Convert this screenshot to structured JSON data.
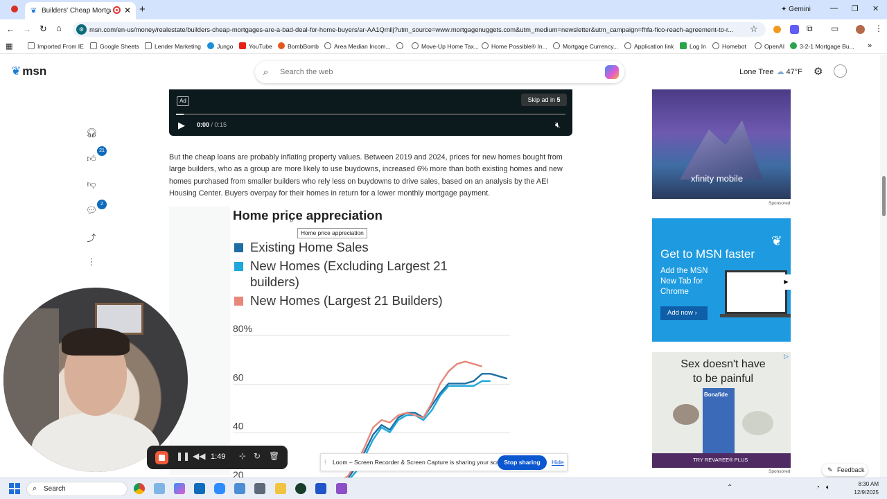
{
  "browser": {
    "tab_title": "Builders' Cheap Mortgages",
    "new_tab": "+",
    "gemini_label": "Gemini",
    "url": "msn.com/en-us/money/realestate/builders-cheap-mortgages-are-a-bad-deal-for-home-buyers/ar-AA1Qmilj?utm_source=www.mortgagenuggets.com&utm_medium=newsletter&utm_campaign=fhfa-fico-reach-agreement-to-r...",
    "bookmarks": [
      {
        "label": "Imported From IE",
        "color": "#6b6b6b"
      },
      {
        "label": "Google Sheets",
        "color": "#6b6b6b"
      },
      {
        "label": "Lender Marketing",
        "color": "#6b6b6b"
      },
      {
        "label": "Jungo",
        "color": "#1c8fd6"
      },
      {
        "label": "YouTube",
        "color": "#e62117"
      },
      {
        "label": "BombBomb",
        "color": "#e2591d"
      },
      {
        "label": "Area Median Incom...",
        "color": "#555555"
      },
      {
        "label": "Move-Up Home Tax...",
        "color": "#555555"
      },
      {
        "label": "Home Possible® In...",
        "color": "#555555"
      },
      {
        "label": "Mortgage Currency...",
        "color": "#555555"
      },
      {
        "label": "Application link",
        "color": "#555555"
      },
      {
        "label": "Log In",
        "color": "#2aa34a"
      },
      {
        "label": "Homebot",
        "color": "#555555"
      },
      {
        "label": "OpenAI",
        "color": "#555555"
      },
      {
        "label": "3-2-1 Mortgage Bu...",
        "color": "#2aa34a"
      }
    ]
  },
  "msn": {
    "logo": "msn",
    "search_placeholder": "Search the web",
    "location": "Lone Tree",
    "temperature": "47°F"
  },
  "left_rail": {
    "like_count": "21",
    "comment_count": "2"
  },
  "video": {
    "ad_label": "Ad",
    "skip_label": "Skip ad in",
    "skip_seconds": "5",
    "time_current": "0:00",
    "time_total": "/ 0:15",
    "progress_fraction": 0.02
  },
  "article": {
    "paragraph": "But the cheap loans are probably inflating property values. Between 2019 and 2024, prices for new homes bought from large builders, who as a group are more likely to use buydowns, increased 6% more than both existing homes and new homes purchased from smaller builders who rely less on buydowns to drive sales, based on an analysis by the AEI Housing Center. Buyers overpay for their homes in return for a lower monthly mortgage payment."
  },
  "chart_data": {
    "type": "line",
    "title": "Home price appreciation",
    "tooltip": "Home price appreciation",
    "ylim": [
      20,
      80
    ],
    "yticks": [
      {
        "value": 80,
        "label": "80%"
      },
      {
        "value": 60,
        "label": "60"
      },
      {
        "value": 40,
        "label": "40"
      },
      {
        "value": 20,
        "label": "20"
      }
    ],
    "x": [
      0,
      1,
      2,
      3,
      4,
      5,
      6,
      7,
      8,
      9,
      10,
      11,
      12,
      13,
      14,
      15,
      16,
      17,
      18,
      19,
      20
    ],
    "series": [
      {
        "name": "Existing Home Sales",
        "color": "#1d6fa3",
        "values": [
          18,
          19,
          24,
          30,
          37,
          41,
          39,
          44,
          46,
          46,
          44,
          49,
          54,
          58,
          58,
          58,
          59,
          62,
          62,
          61,
          60
        ]
      },
      {
        "name": "New Homes (Excluding Largest 21 builders)",
        "color": "#1ea8dc",
        "values": [
          17,
          18,
          22,
          28,
          35,
          40,
          38,
          43,
          45,
          45,
          43,
          47,
          53,
          57,
          57,
          57,
          57,
          59,
          59,
          null,
          null
        ]
      },
      {
        "name": "New Homes (Largest 21 Builders)",
        "color": "#e8877a",
        "values": [
          18,
          20,
          25,
          32,
          40,
          43,
          42,
          45,
          46,
          45,
          44,
          50,
          58,
          63,
          66,
          67,
          66,
          65,
          null,
          null,
          null
        ]
      }
    ]
  },
  "ads": {
    "sponsored_label": "Sponsored",
    "ad1_brand": "xfinity mobile",
    "ad2_headline": "Get to MSN faster",
    "ad2_body": "Add the MSN New Tab for Chrome",
    "ad2_button": "Add now",
    "ad3_headline": "Sex doesn't have to be painful",
    "ad3_brand": "Bonafide",
    "ad3_cta": "TRY REVAREE® PLUS"
  },
  "recorder": {
    "timer": "1:49",
    "share_message": "Loom – Screen Recorder & Screen Capture is sharing your screen.",
    "stop_sharing": "Stop sharing",
    "hide": "Hide"
  },
  "feedback_label": "Feedback",
  "taskbar": {
    "search": "Search",
    "time": "8:30 AM",
    "date": "12/9/2025"
  }
}
